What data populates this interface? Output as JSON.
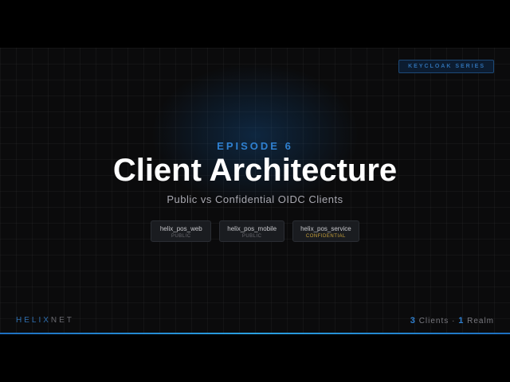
{
  "badge": "KEYCLOAK SERIES",
  "episode": "EPISODE 6",
  "title": "Client Architecture",
  "subtitle": "Public vs Confidential OIDC Clients",
  "clients": [
    {
      "name": "helix_pos_web",
      "type": "PUBLIC",
      "color": "#6a6a70"
    },
    {
      "name": "helix_pos_mobile",
      "type": "PUBLIC",
      "color": "#6a6a70"
    },
    {
      "name": "helix_pos_service",
      "type": "CONFIDENTIAL",
      "color": "#c9a23a"
    }
  ],
  "brand": {
    "part1": "HELIX",
    "part2": "NET"
  },
  "stats": {
    "clients_count": "3",
    "clients_label": "Clients",
    "sep": "·",
    "realm_count": "1",
    "realm_label": "Realm"
  }
}
